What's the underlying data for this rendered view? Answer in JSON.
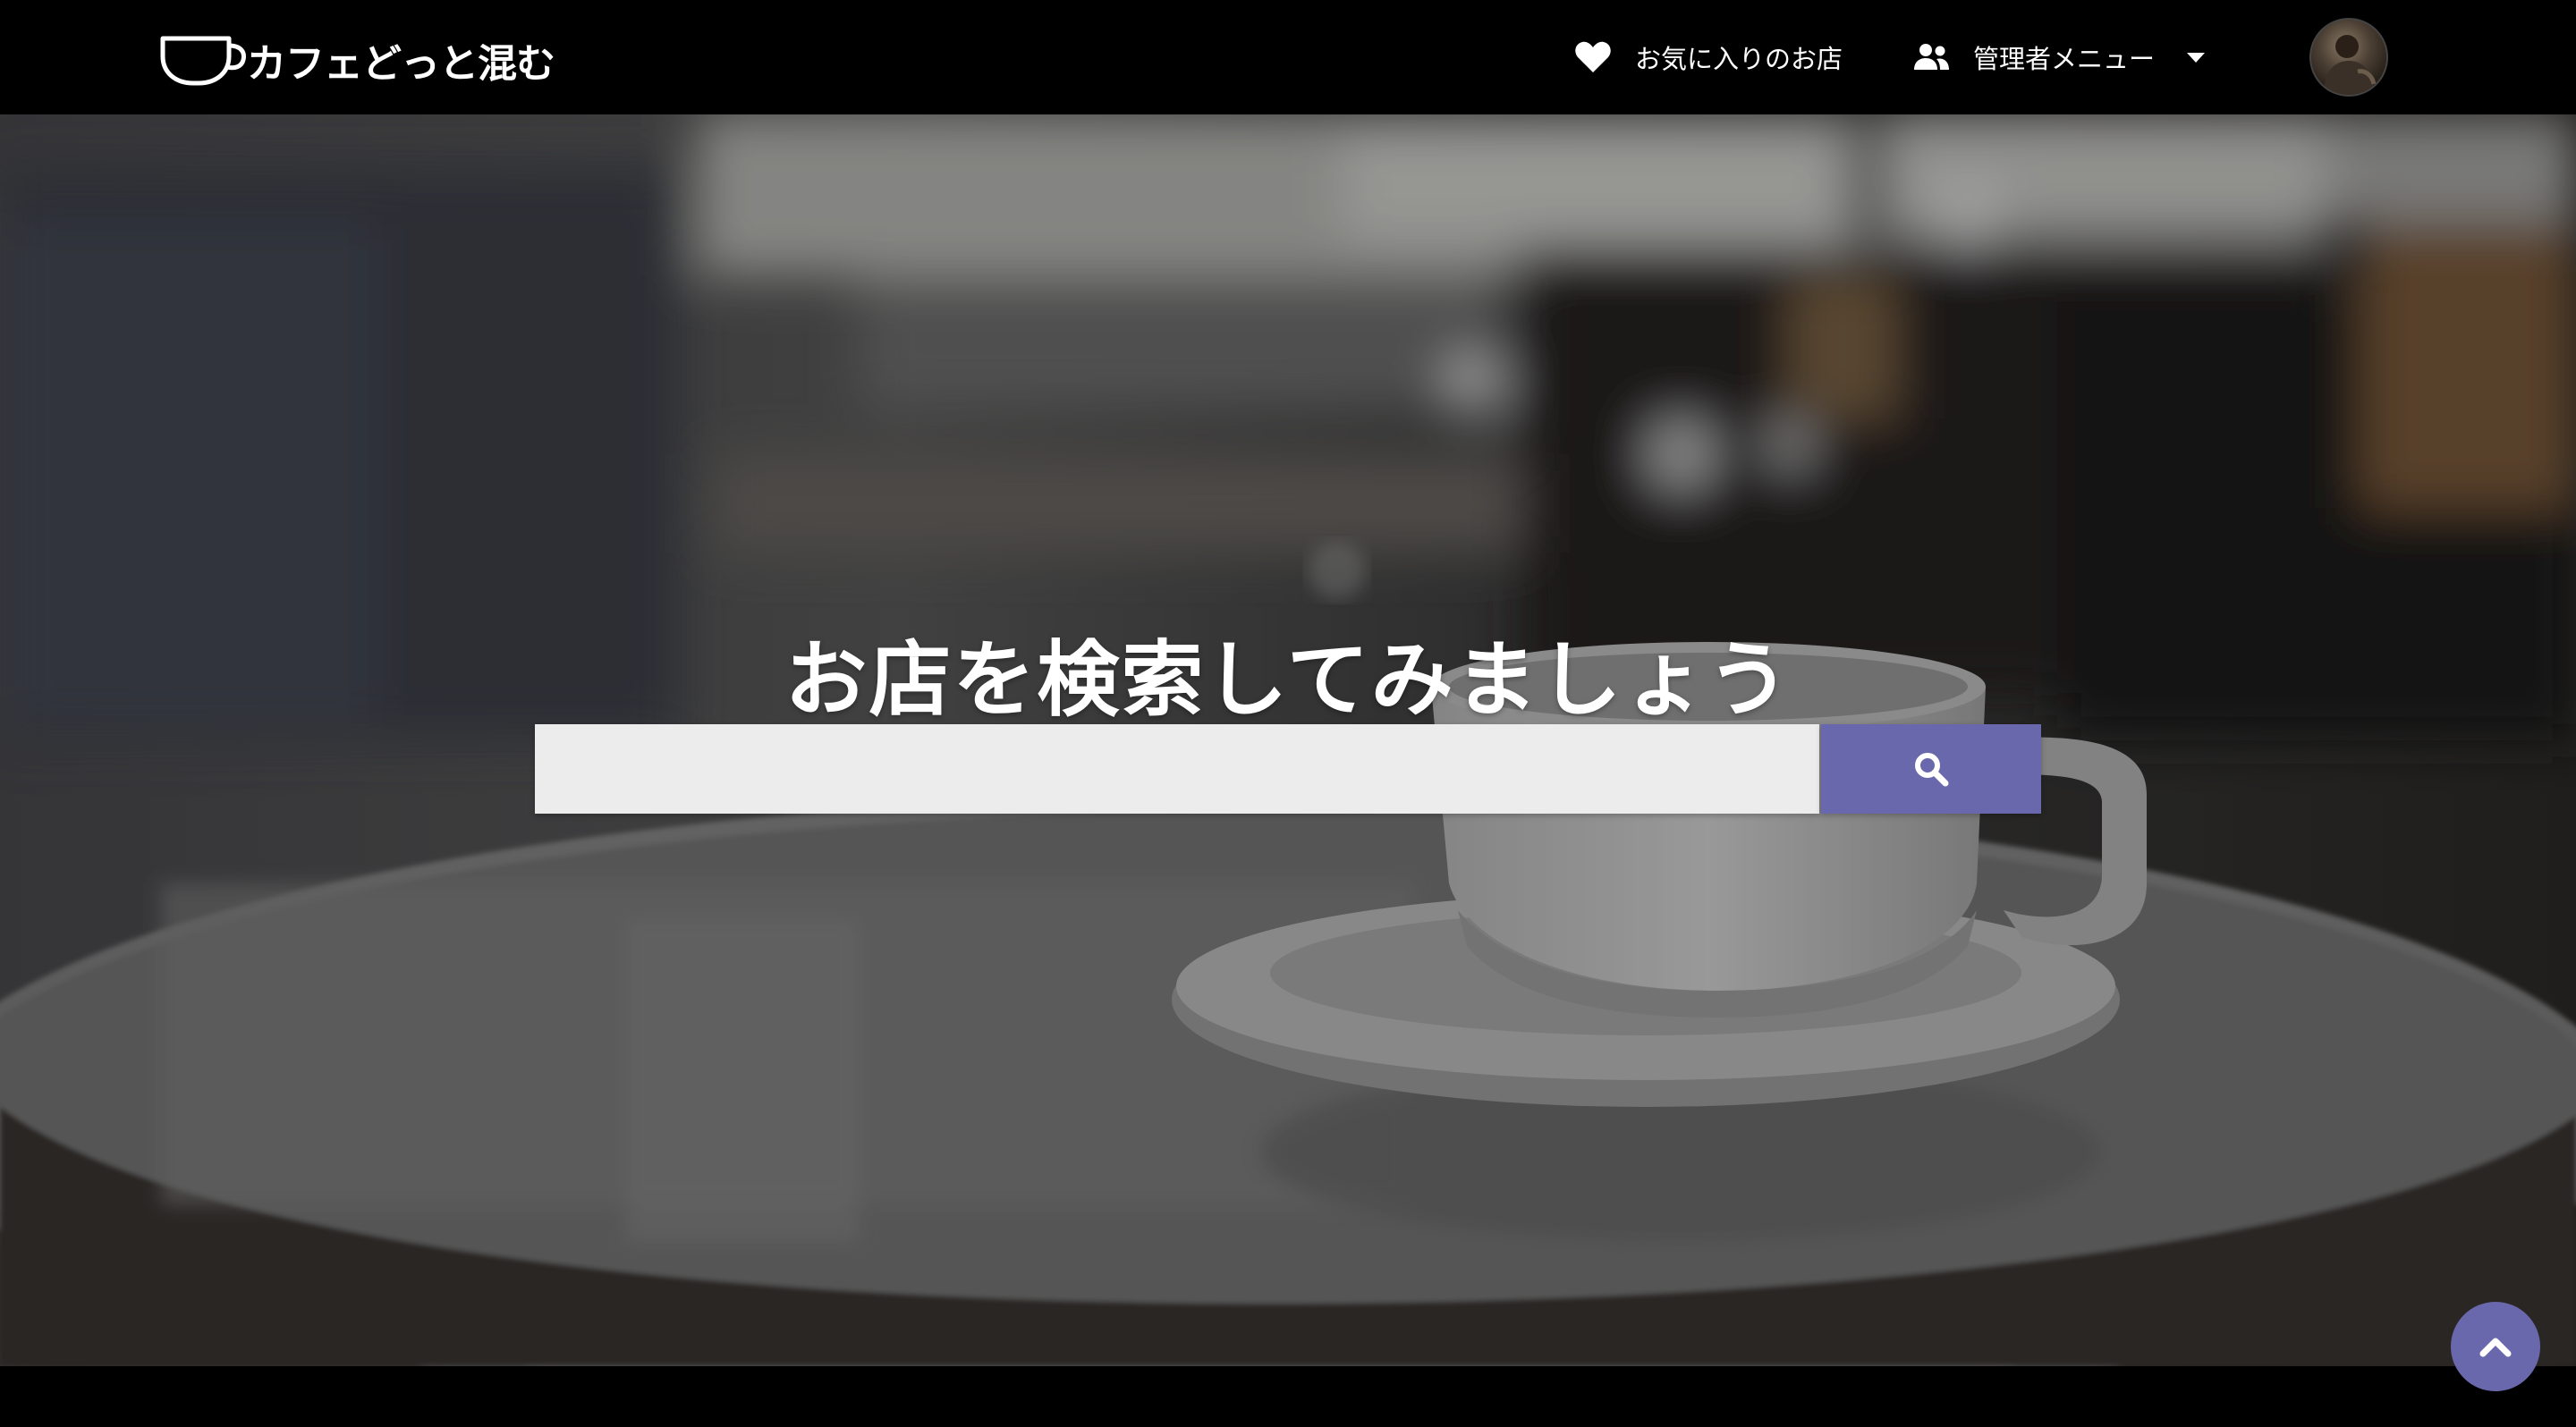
{
  "brand": {
    "name": "カフェどっと混む"
  },
  "nav": {
    "favorites_label": "お気に入りのお店",
    "admin_label": "管理者メニュー"
  },
  "hero": {
    "title": "お店を検索してみましょう"
  },
  "search": {
    "value": "",
    "placeholder": ""
  },
  "icons": {
    "logo": "coffee-cup-icon",
    "favorites": "heart-icon",
    "admin": "users-icon",
    "admin_dropdown": "caret-down-icon",
    "search": "magnifier-icon",
    "scroll_top": "chevron-up-icon"
  },
  "colors": {
    "header_bg": "#000000",
    "accent": "#6a68ac",
    "search_field_bg": "#ececec",
    "text_on_dark": "#ffffff"
  }
}
